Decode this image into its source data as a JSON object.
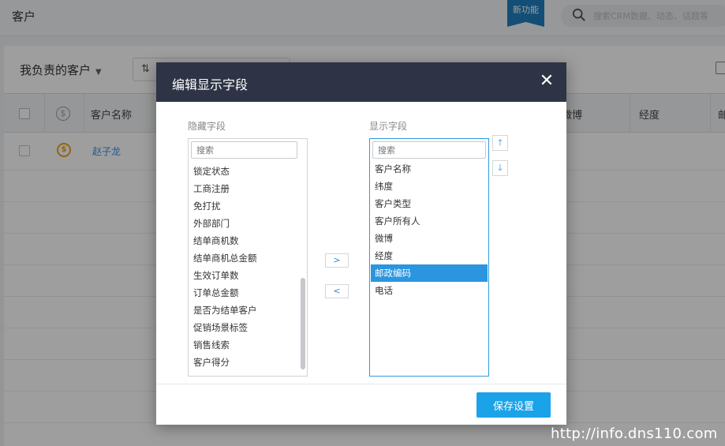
{
  "app": {
    "title": "客户",
    "new_feature_badge": "新功能",
    "search_placeholder": "搜索CRM数据、动态、话题等"
  },
  "list_view": {
    "view_name": "我负责的客户",
    "columns": [
      "客户名称",
      "微博",
      "经度",
      "邮"
    ],
    "rows": [
      {
        "name": "赵子龙"
      }
    ]
  },
  "modal": {
    "title": "编辑显示字段",
    "close_icon": "close-icon",
    "hidden_label": "隐藏字段",
    "shown_label": "显示字段",
    "search_placeholder": "搜索",
    "hidden_fields": [
      "锁定状态",
      "工商注册",
      "免打扰",
      "外部部门",
      "结单商机数",
      "结单商机总金额",
      "生效订单数",
      "订单总金额",
      "是否为结单客户",
      "促销场景标签",
      "销售线索",
      "客户得分"
    ],
    "shown_fields": [
      "客户名称",
      "纬度",
      "客户类型",
      "客户所有人",
      "微博",
      "经度",
      "邮政编码",
      "电话"
    ],
    "selected_shown_field": "邮政编码",
    "move_right_label": ">",
    "move_left_label": "<",
    "move_up_label": "🡑",
    "move_down_label": "🡓",
    "save_label": "保存设置"
  },
  "colors": {
    "accent": "#1aa3e8",
    "selected_item": "#2b96df",
    "modal_header": "#2e3445",
    "badge": "#1f7fbf"
  },
  "watermark": "http://info.dns110.com"
}
